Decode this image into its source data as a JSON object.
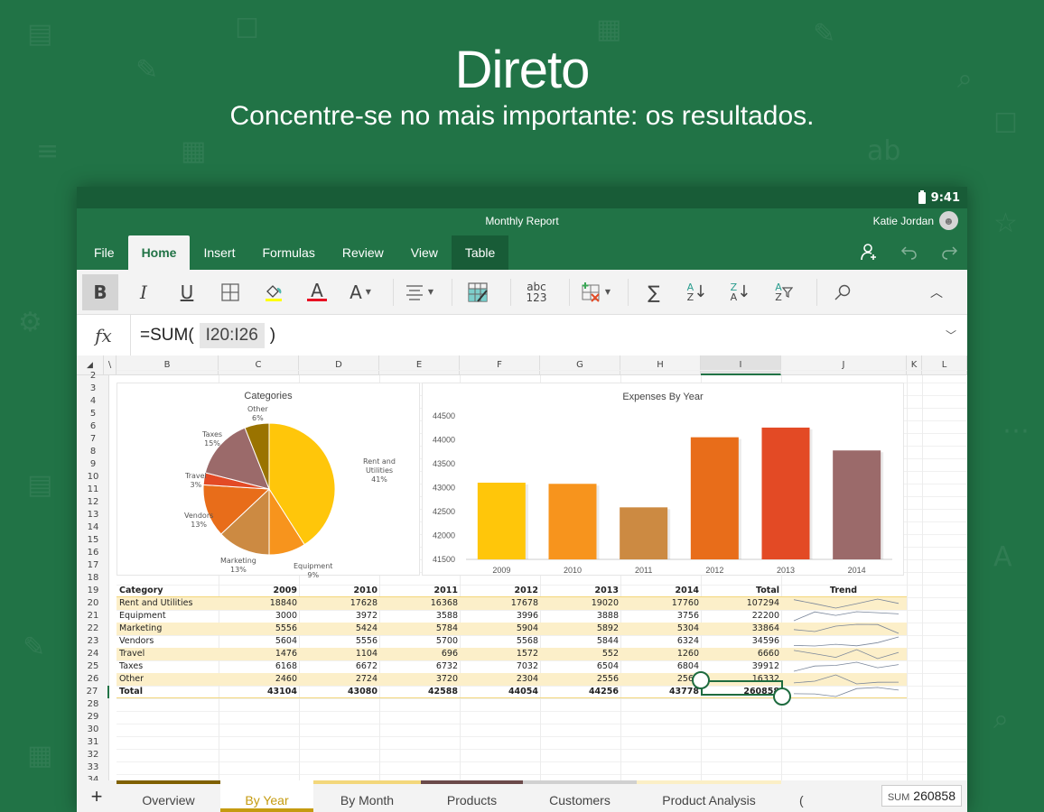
{
  "hero": {
    "title": "Direto",
    "subtitle": "Concentre-se no mais importante: os resultados."
  },
  "status_bar": {
    "time": "9:41",
    "battery_icon": "battery-icon"
  },
  "title_bar": {
    "document_title": "Monthly Report",
    "user_name": "Katie Jordan"
  },
  "ribbon": {
    "tabs": [
      {
        "label": "File",
        "state": "normal"
      },
      {
        "label": "Home",
        "state": "active"
      },
      {
        "label": "Insert",
        "state": "normal"
      },
      {
        "label": "Formulas",
        "state": "normal"
      },
      {
        "label": "Review",
        "state": "normal"
      },
      {
        "label": "View",
        "state": "normal"
      },
      {
        "label": "Table",
        "state": "contextual"
      }
    ],
    "right_actions": [
      "share-person-icon",
      "undo-icon",
      "redo-icon"
    ]
  },
  "toolbar": {
    "bold": "B",
    "italic": "I",
    "underline": "U",
    "font_color_letter": "A",
    "font_size_letter": "A",
    "number_format_top": "abc",
    "number_format_bottom": "123",
    "sum_symbol": "∑",
    "sort_asc_top": "A",
    "sort_asc_bottom": "Z",
    "sort_desc_top": "Z",
    "sort_desc_bottom": "A",
    "filter_top": "A",
    "filter_bottom": "Z",
    "highlight_color": "#ffff00",
    "font_color": "#e81123"
  },
  "formula_bar": {
    "fx_label": "fx",
    "prefix": "=SUM(",
    "reference": "I20:I26",
    "suffix": ")"
  },
  "grid": {
    "columns": [
      "\\",
      "B",
      "C",
      "D",
      "E",
      "F",
      "G",
      "H",
      "I",
      "J",
      "K",
      "L"
    ],
    "selected_column": "I",
    "rows": [
      "2",
      "3",
      "4",
      "5",
      "6",
      "7",
      "8",
      "9",
      "10",
      "11",
      "12",
      "13",
      "14",
      "15",
      "16",
      "17",
      "18",
      "19",
      "20",
      "21",
      "22",
      "23",
      "24",
      "25",
      "26",
      "27",
      "28",
      "29",
      "30",
      "31",
      "32",
      "33",
      "34"
    ]
  },
  "chart_data": [
    {
      "type": "pie",
      "title": "Categories",
      "labels": [
        "Rent and Utilities",
        "Equipment",
        "Marketing",
        "Vendors",
        "Travel",
        "Taxes",
        "Other"
      ],
      "values": [
        41,
        9,
        13,
        13,
        3,
        15,
        6
      ],
      "value_labels": [
        "41%",
        "9%",
        "13%",
        "13%",
        "3%",
        "15%",
        "6%"
      ],
      "colors": [
        "#ffc60a",
        "#f7941d",
        "#cc8a42",
        "#e86d1a",
        "#e34a25",
        "#9b6a6a",
        "#9a7300"
      ]
    },
    {
      "type": "bar",
      "title": "Expenses By Year",
      "categories": [
        "2009",
        "2010",
        "2011",
        "2012",
        "2013",
        "2014"
      ],
      "values": [
        43104,
        43080,
        42588,
        44054,
        44256,
        43778
      ],
      "colors": [
        "#ffc60a",
        "#f7941d",
        "#cc8a42",
        "#e86d1a",
        "#e34a25",
        "#9b6a6a"
      ],
      "yticks": [
        "41500",
        "42000",
        "42500",
        "43000",
        "43500",
        "44000",
        "44500"
      ],
      "ylim": [
        41500,
        44500
      ],
      "xlabel": "",
      "ylabel": "",
      "grid": false
    }
  ],
  "table": {
    "headers": [
      "Category",
      "2009",
      "2010",
      "2011",
      "2012",
      "2013",
      "2014",
      "Total",
      "Trend"
    ],
    "rows": [
      {
        "category": "Rent and Utilities",
        "values": [
          "18840",
          "17628",
          "16368",
          "17678",
          "19020",
          "17760"
        ],
        "total": "107294",
        "trend": [
          18840,
          17628,
          16368,
          17678,
          19020,
          17760
        ]
      },
      {
        "category": "Equipment",
        "values": [
          "3000",
          "3972",
          "3588",
          "3996",
          "3888",
          "3756"
        ],
        "total": "22200",
        "trend": [
          3000,
          3972,
          3588,
          3996,
          3888,
          3756
        ]
      },
      {
        "category": "Marketing",
        "values": [
          "5556",
          "5424",
          "5784",
          "5904",
          "5892",
          "5304"
        ],
        "total": "33864",
        "trend": [
          5556,
          5424,
          5784,
          5904,
          5892,
          5304
        ]
      },
      {
        "category": "Vendors",
        "values": [
          "5604",
          "5556",
          "5700",
          "5568",
          "5844",
          "6324"
        ],
        "total": "34596",
        "trend": [
          5604,
          5556,
          5700,
          5568,
          5844,
          6324
        ]
      },
      {
        "category": "Travel",
        "values": [
          "1476",
          "1104",
          "696",
          "1572",
          "552",
          "1260"
        ],
        "total": "6660",
        "trend": [
          1476,
          1104,
          696,
          1572,
          552,
          1260
        ]
      },
      {
        "category": "Taxes",
        "values": [
          "6168",
          "6672",
          "6732",
          "7032",
          "6504",
          "6804"
        ],
        "total": "39912",
        "trend": [
          6168,
          6672,
          6732,
          7032,
          6504,
          6804
        ]
      },
      {
        "category": "Other",
        "values": [
          "2460",
          "2724",
          "3720",
          "2304",
          "2556",
          "2568"
        ],
        "total": "16332",
        "trend": [
          2460,
          2724,
          3720,
          2304,
          2556,
          2568
        ]
      }
    ],
    "total_row": {
      "category": "Total",
      "values": [
        "43104",
        "43080",
        "42588",
        "44054",
        "44256",
        "43778"
      ],
      "total": "260858",
      "trend": [
        43104,
        43080,
        42588,
        44054,
        44256,
        43778
      ]
    }
  },
  "sheet_tabs": [
    {
      "label": "Overview",
      "color": "#7f6000",
      "active": false
    },
    {
      "label": "By Year",
      "color": "#c59b10",
      "active": true
    },
    {
      "label": "By Month",
      "color": "#f3d77b",
      "active": false
    },
    {
      "label": "Products",
      "color": "#6b4a4a",
      "active": false
    },
    {
      "label": "Customers",
      "color": "#d0d0d0",
      "active": false
    },
    {
      "label": "Product Analysis",
      "color": "#fbefc6",
      "active": false
    },
    {
      "label": "(",
      "color": "",
      "active": false
    }
  ],
  "status": {
    "sum_label": "SUM",
    "sum_value": "260858"
  }
}
